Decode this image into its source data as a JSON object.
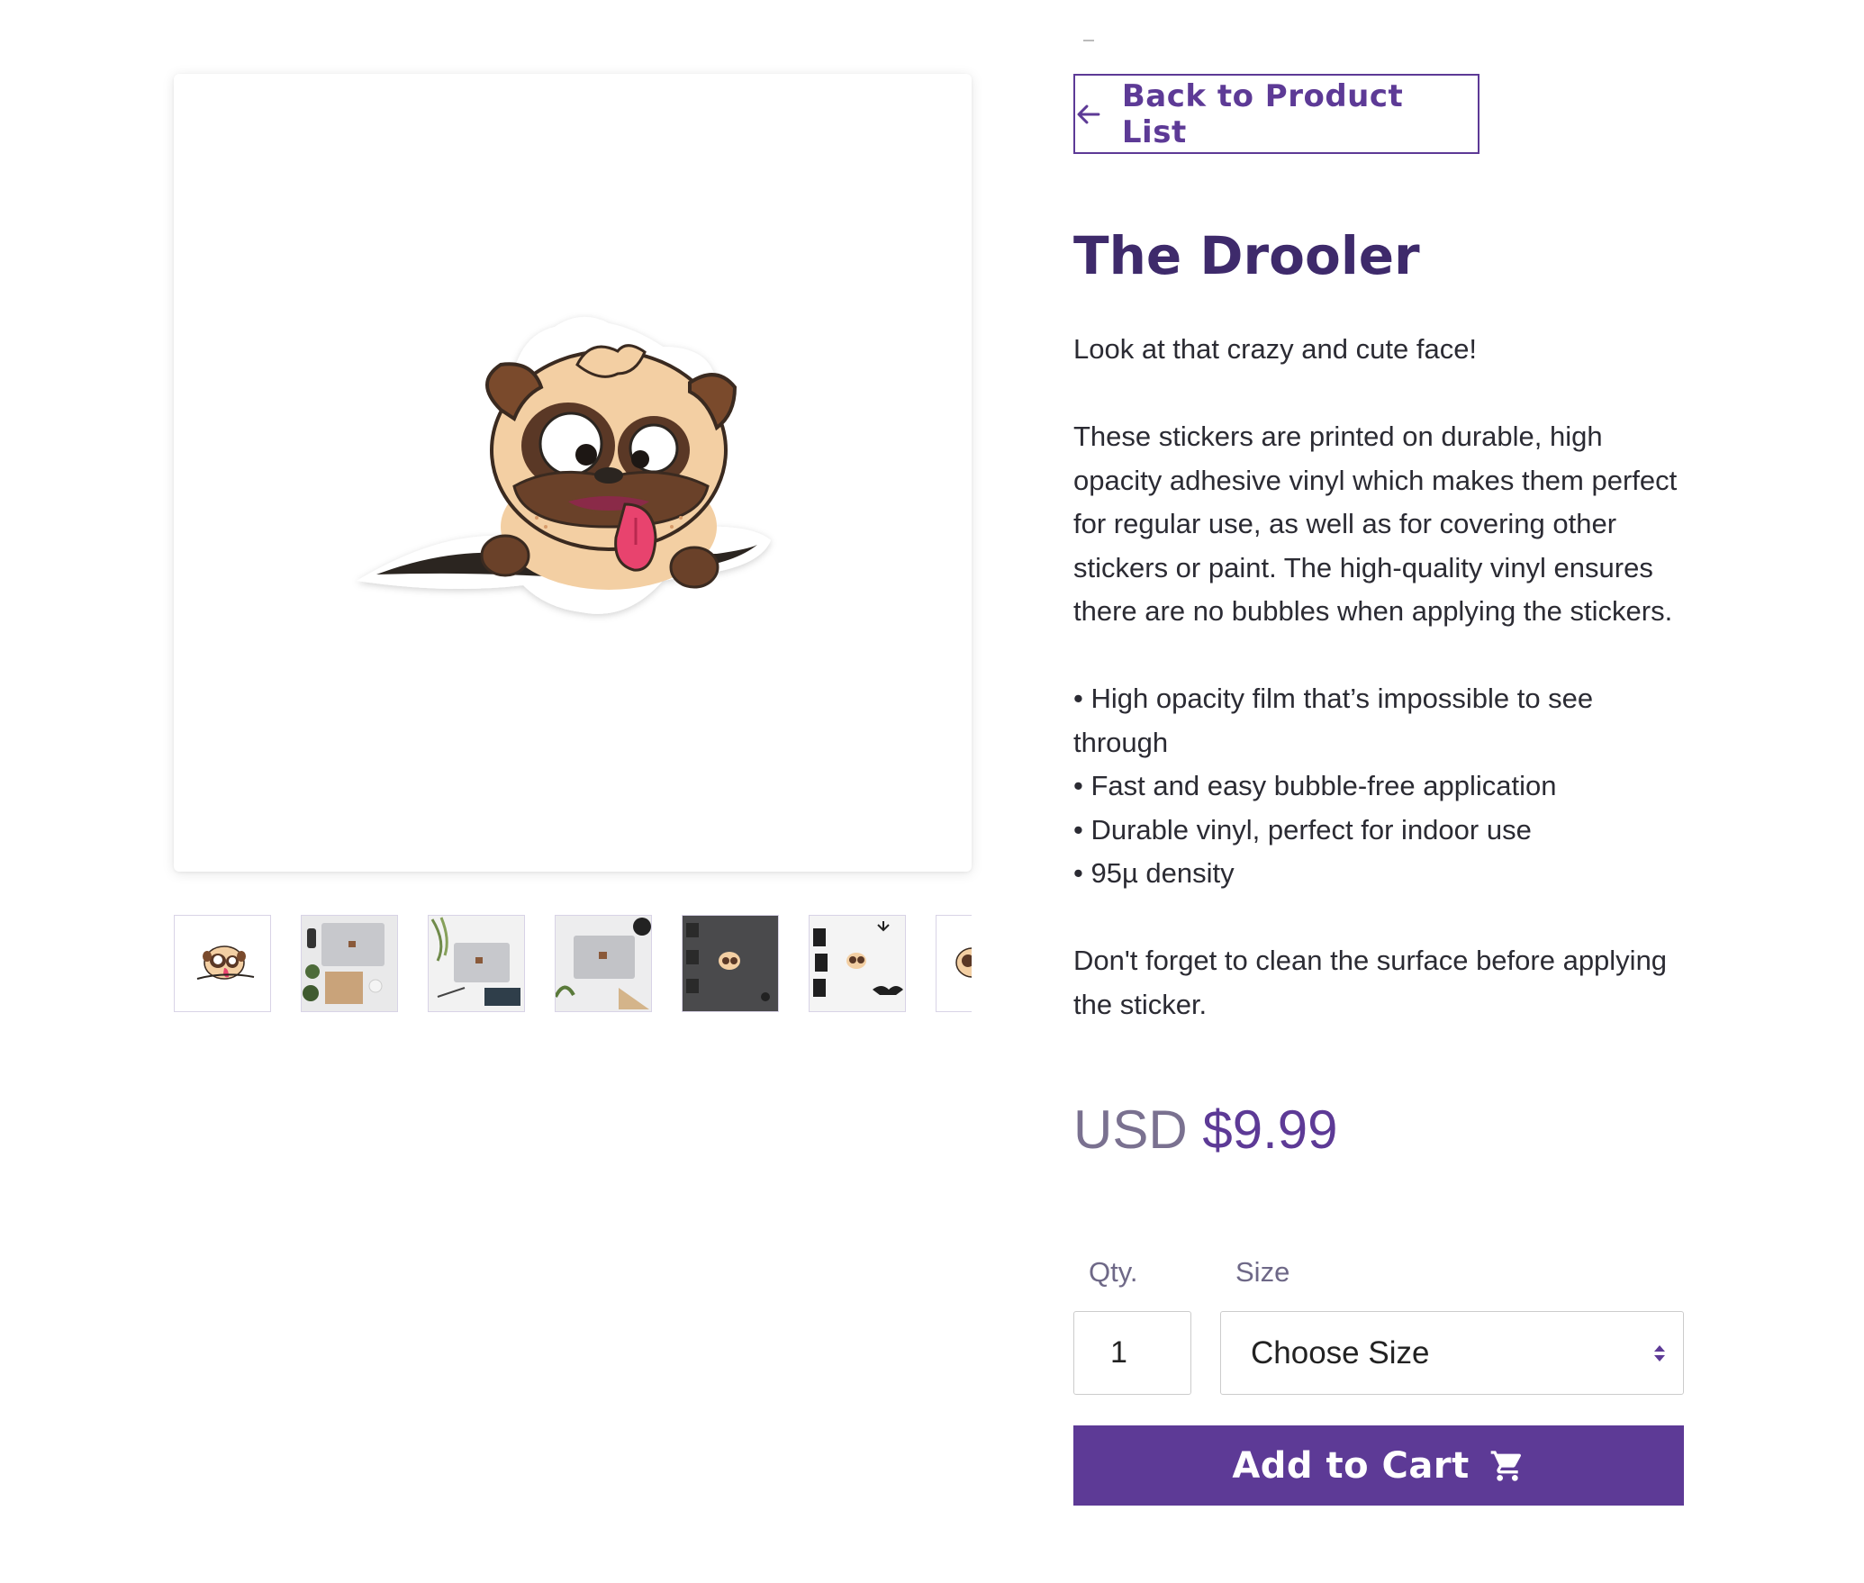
{
  "navigation": {
    "back_label": "Back to Product List"
  },
  "product": {
    "title": "The Drooler",
    "description": [
      "Look at that crazy and cute face!",
      "These stickers are printed on durable, high opacity adhesive vinyl which makes them perfect for regular use, as well as for covering other stickers or paint. The high-quality vinyl ensures there are no bubbles when applying the stickers."
    ],
    "features": [
      "• High opacity film that’s impossible to see through",
      "• Fast and easy bubble-free application",
      "• Durable vinyl, perfect for indoor use",
      "• 95µ density"
    ],
    "note": "Don't forget to clean the surface before applying the sticker.",
    "price_currency": "USD",
    "price_amount": "$9.99"
  },
  "purchase": {
    "qty_label": "Qty.",
    "qty_value": "1",
    "size_label": "Size",
    "size_selected": "Choose Size",
    "add_to_cart_label": "Add to Cart"
  },
  "gallery": {
    "thumbnails": [
      {
        "name": "pug-sticker",
        "selected": true
      },
      {
        "name": "laptop-flatlay"
      },
      {
        "name": "laptop-plant"
      },
      {
        "name": "laptop-desk"
      },
      {
        "name": "dark-boo"
      },
      {
        "name": "boo-bats"
      },
      {
        "name": "pug-partial"
      }
    ]
  },
  "colors": {
    "brand": "#5d3a96",
    "title": "#3e2a6b",
    "muted": "#7a7190"
  }
}
